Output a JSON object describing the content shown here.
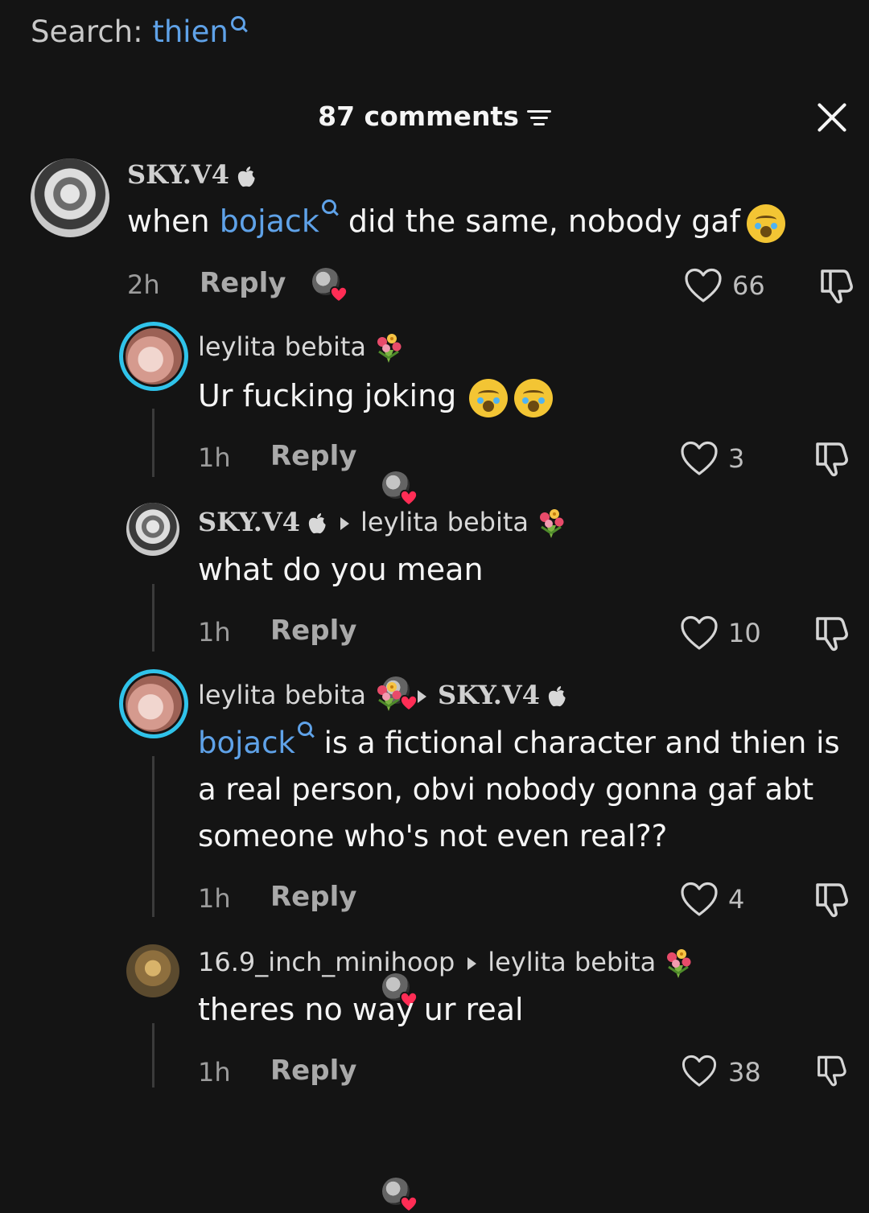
{
  "search": {
    "label": "Search: ",
    "term": "thien"
  },
  "header": {
    "comment_count": "87 comments"
  },
  "comments": [
    {
      "author": "SKY.V4",
      "text_before": "when ",
      "mention": "bojack",
      "text_after": " did the same, nobody gaf",
      "time": "2h",
      "reply": "Reply",
      "likes": "66"
    },
    {
      "author": "leylita bebita",
      "text": "Ur fucking joking",
      "time": "1h",
      "reply": "Reply",
      "likes": "3"
    },
    {
      "author": "SKY.V4",
      "reply_to": "leylita bebita",
      "text": "what do you mean",
      "time": "1h",
      "reply": "Reply",
      "likes": "10"
    },
    {
      "author": "leylita bebita",
      "reply_to": "SKY.V4",
      "mention": "bojack",
      "line1": " is a fictional character and thien is",
      "line2": "a real person, obvi nobody gonna gaf abt",
      "line3": "someone who's not even real??",
      "time": "1h",
      "reply": "Reply",
      "likes": "4"
    },
    {
      "author": "16.9_inch_minihoop",
      "reply_to": "leylita bebita",
      "text": "theres no way ur real",
      "time": "1h",
      "reply": "Reply",
      "likes": "38"
    }
  ],
  "icons": {
    "search": "magnifier-icon",
    "filter": "filter-icon",
    "close": "close-icon",
    "like": "heart-outline-icon",
    "dislike": "thumbs-down-icon",
    "verified": "apple-icon",
    "flowers": "bouquet-emoji",
    "crying": "loudly-crying-emoji"
  },
  "colors": {
    "mention": "#5fa2e8",
    "story_ring": "#2fc3ea",
    "background": "#141414"
  }
}
